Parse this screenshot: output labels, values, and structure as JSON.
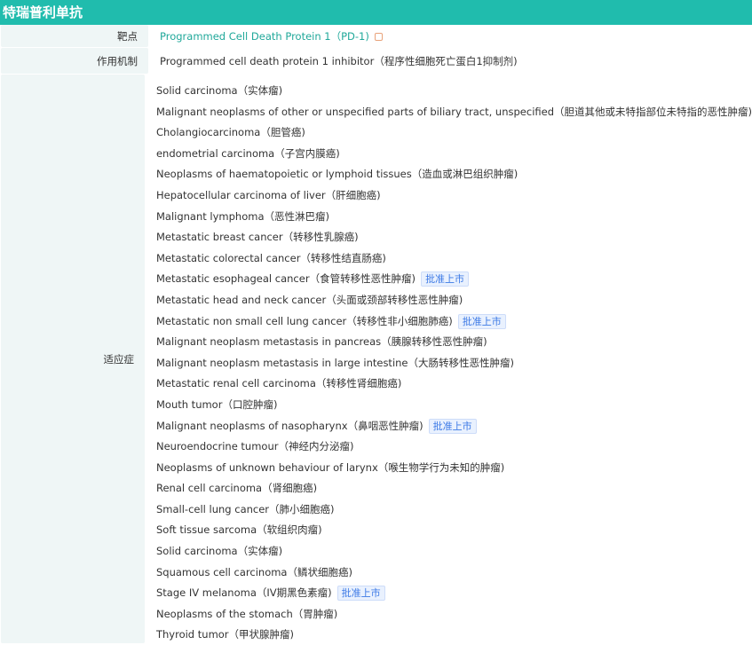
{
  "title": "特瑞普利单抗",
  "target": {
    "label": "靶点",
    "value": "Programmed Cell Death Protein 1（PD-1)",
    "icon": "external-link-icon"
  },
  "mechanism": {
    "label": "作用机制",
    "value": "Programmed cell death protein 1 inhibitor（程序性细胞死亡蛋白1抑制剂)"
  },
  "indications": {
    "label": "适应症",
    "approved_tag": "批准上市",
    "items": [
      {
        "text": "Solid carcinoma（实体瘤)",
        "approved": false
      },
      {
        "text": "Malignant neoplasms of other or unspecified parts of biliary tract, unspecified（胆道其他或未特指部位未特指的恶性肿瘤)",
        "approved": false
      },
      {
        "text": "Cholangiocarcinoma（胆管癌)",
        "approved": false
      },
      {
        "text": "endometrial carcinoma（子宫内膜癌)",
        "approved": false
      },
      {
        "text": "Neoplasms of haematopoietic or lymphoid tissues（造血或淋巴组织肿瘤)",
        "approved": false
      },
      {
        "text": "Hepatocellular carcinoma of liver（肝细胞癌)",
        "approved": false
      },
      {
        "text": "Malignant lymphoma（恶性淋巴瘤)",
        "approved": false
      },
      {
        "text": "Metastatic breast cancer（转移性乳腺癌)",
        "approved": false
      },
      {
        "text": "Metastatic colorectal cancer（转移性结直肠癌)",
        "approved": false
      },
      {
        "text": "Metastatic esophageal cancer（食管转移性恶性肿瘤)",
        "approved": true
      },
      {
        "text": "Metastatic head and neck cancer（头面或颈部转移性恶性肿瘤)",
        "approved": false
      },
      {
        "text": "Metastatic non small cell lung cancer（转移性非小细胞肺癌)",
        "approved": true
      },
      {
        "text": "Malignant neoplasm metastasis in pancreas（胰腺转移性恶性肿瘤)",
        "approved": false
      },
      {
        "text": "Malignant neoplasm metastasis in large intestine（大肠转移性恶性肿瘤)",
        "approved": false
      },
      {
        "text": "Metastatic renal cell carcinoma（转移性肾细胞癌)",
        "approved": false
      },
      {
        "text": "Mouth tumor（口腔肿瘤)",
        "approved": false
      },
      {
        "text": "Malignant neoplasms of nasopharynx（鼻咽恶性肿瘤)",
        "approved": true
      },
      {
        "text": "Neuroendocrine tumour（神经内分泌瘤)",
        "approved": false
      },
      {
        "text": "Neoplasms of unknown behaviour of larynx（喉生物学行为未知的肿瘤)",
        "approved": false
      },
      {
        "text": "Renal cell carcinoma（肾细胞癌)",
        "approved": false
      },
      {
        "text": "Small-cell lung cancer（肺小细胞癌)",
        "approved": false
      },
      {
        "text": "Soft tissue sarcoma（软组织肉瘤)",
        "approved": false
      },
      {
        "text": "Solid carcinoma（实体瘤)",
        "approved": false
      },
      {
        "text": "Squamous cell carcinoma（鳞状细胞癌)",
        "approved": false
      },
      {
        "text": "Stage IV melanoma（IV期黑色素瘤)",
        "approved": true
      },
      {
        "text": "Neoplasms of the stomach（胃肿瘤)",
        "approved": false
      },
      {
        "text": "Thyroid tumor（甲状腺肿瘤)",
        "approved": false
      }
    ]
  },
  "colors": {
    "header": "#20bcad",
    "link": "#20a89a",
    "tag": "#3d7ae6"
  }
}
